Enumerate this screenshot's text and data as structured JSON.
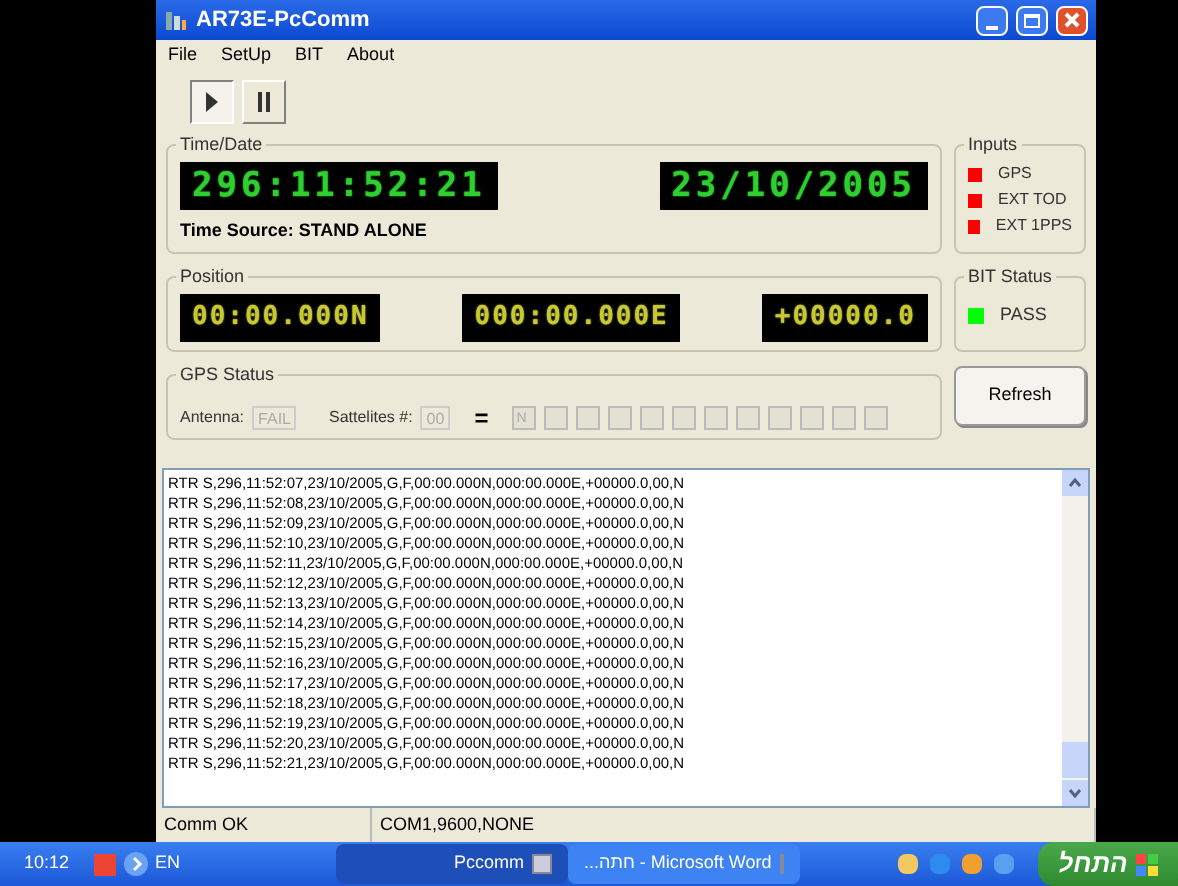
{
  "window": {
    "title": "AR73E-PcComm"
  },
  "menu": [
    {
      "label": "File"
    },
    {
      "label": "SetUp"
    },
    {
      "label": "BIT"
    },
    {
      "label": "About"
    }
  ],
  "toolbar": [
    {
      "kind": "play",
      "pressed": true
    },
    {
      "kind": "pause",
      "pressed": false
    }
  ],
  "time_date": {
    "title": "Time/Date",
    "time_display": "296:11:52:21",
    "date_display": "23/10/2005",
    "time_source": "Time Source: STAND ALONE"
  },
  "inputs": {
    "title": "Inputs",
    "items": [
      {
        "label": "GPS",
        "color": "#ff0000"
      },
      {
        "label": "EXT TOD",
        "color": "#ff0000"
      },
      {
        "label": "EXT 1PPS",
        "color": "#ff0000"
      }
    ]
  },
  "position": {
    "title": "Position",
    "displays": [
      "00:00.000N",
      "000:00.000E",
      "+00000.0"
    ]
  },
  "bit_status": {
    "title": "BIT Status",
    "items": [
      {
        "label": "PASS",
        "color": "#00ff00"
      }
    ]
  },
  "gps_status": {
    "title": "GPS Status",
    "antenna_label": "Antenna:",
    "antenna_value": "FAIL",
    "satellites_label": "Sattelites #:",
    "satellites_value": "00",
    "equals": "=",
    "satellite_cells": [
      {
        "kind": "letter",
        "text": "N"
      },
      {
        "kind": "blank"
      },
      {
        "kind": "blank"
      },
      {
        "kind": "blank"
      },
      {
        "kind": "blank"
      },
      {
        "kind": "blank"
      },
      {
        "kind": "blank"
      },
      {
        "kind": "blank"
      },
      {
        "kind": "blank"
      },
      {
        "kind": "blank"
      },
      {
        "kind": "blank"
      },
      {
        "kind": "blank"
      }
    ]
  },
  "refresh_button": "Refresh",
  "log": {
    "lines": [
      "RTR S,296,11:52:07,23/10/2005,G,F,00:00.000N,000:00.000E,+00000.0,00,N",
      "RTR S,296,11:52:08,23/10/2005,G,F,00:00.000N,000:00.000E,+00000.0,00,N",
      "RTR S,296,11:52:09,23/10/2005,G,F,00:00.000N,000:00.000E,+00000.0,00,N",
      "RTR S,296,11:52:10,23/10/2005,G,F,00:00.000N,000:00.000E,+00000.0,00,N",
      "RTR S,296,11:52:11,23/10/2005,G,F,00:00.000N,000:00.000E,+00000.0,00,N",
      "RTR S,296,11:52:12,23/10/2005,G,F,00:00.000N,000:00.000E,+00000.0,00,N",
      "RTR S,296,11:52:13,23/10/2005,G,F,00:00.000N,000:00.000E,+00000.0,00,N",
      "RTR S,296,11:52:14,23/10/2005,G,F,00:00.000N,000:00.000E,+00000.0,00,N",
      "RTR S,296,11:52:15,23/10/2005,G,F,00:00.000N,000:00.000E,+00000.0,00,N",
      "RTR S,296,11:52:16,23/10/2005,G,F,00:00.000N,000:00.000E,+00000.0,00,N",
      "RTR S,296,11:52:17,23/10/2005,G,F,00:00.000N,000:00.000E,+00000.0,00,N",
      "RTR S,296,11:52:18,23/10/2005,G,F,00:00.000N,000:00.000E,+00000.0,00,N",
      "RTR S,296,11:52:19,23/10/2005,G,F,00:00.000N,000:00.000E,+00000.0,00,N",
      "RTR S,296,11:52:20,23/10/2005,G,F,00:00.000N,000:00.000E,+00000.0,00,N",
      "RTR S,296,11:52:21,23/10/2005,G,F,00:00.000N,000:00.000E,+00000.0,00,N"
    ]
  },
  "status_bar": [
    {
      "text": "Comm OK"
    },
    {
      "text": "COM1,9600,NONE"
    }
  ],
  "taskbar": {
    "clock": "10:12",
    "language": "EN",
    "tasks": [
      {
        "label": "Pccomm",
        "selected": true
      },
      {
        "label": "Microsoft Word - חתה...",
        "selected": false
      }
    ],
    "start": "התחל"
  }
}
